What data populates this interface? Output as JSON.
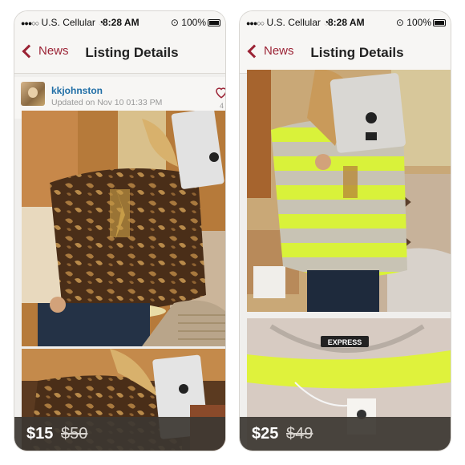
{
  "screens": [
    {
      "status": {
        "carrier": "U.S. Cellular",
        "time": "8:28 AM",
        "battery": "100%"
      },
      "nav": {
        "back_label": "News",
        "title": "Listing Details"
      },
      "user": {
        "username": "kkjohnston",
        "updated": "Updated on Nov 10 01:33 PM",
        "likes": "4"
      },
      "price": {
        "current": "$15",
        "original": "$50"
      }
    },
    {
      "status": {
        "carrier": "U.S. Cellular",
        "time": "8:28 AM",
        "battery": "100%"
      },
      "nav": {
        "back_label": "News",
        "title": "Listing Details"
      },
      "price": {
        "current": "$25",
        "original": "$49"
      },
      "tag_text": "EXPRESS"
    }
  ],
  "colors": {
    "accent": "#9b2335",
    "username": "#1f6ea6"
  }
}
